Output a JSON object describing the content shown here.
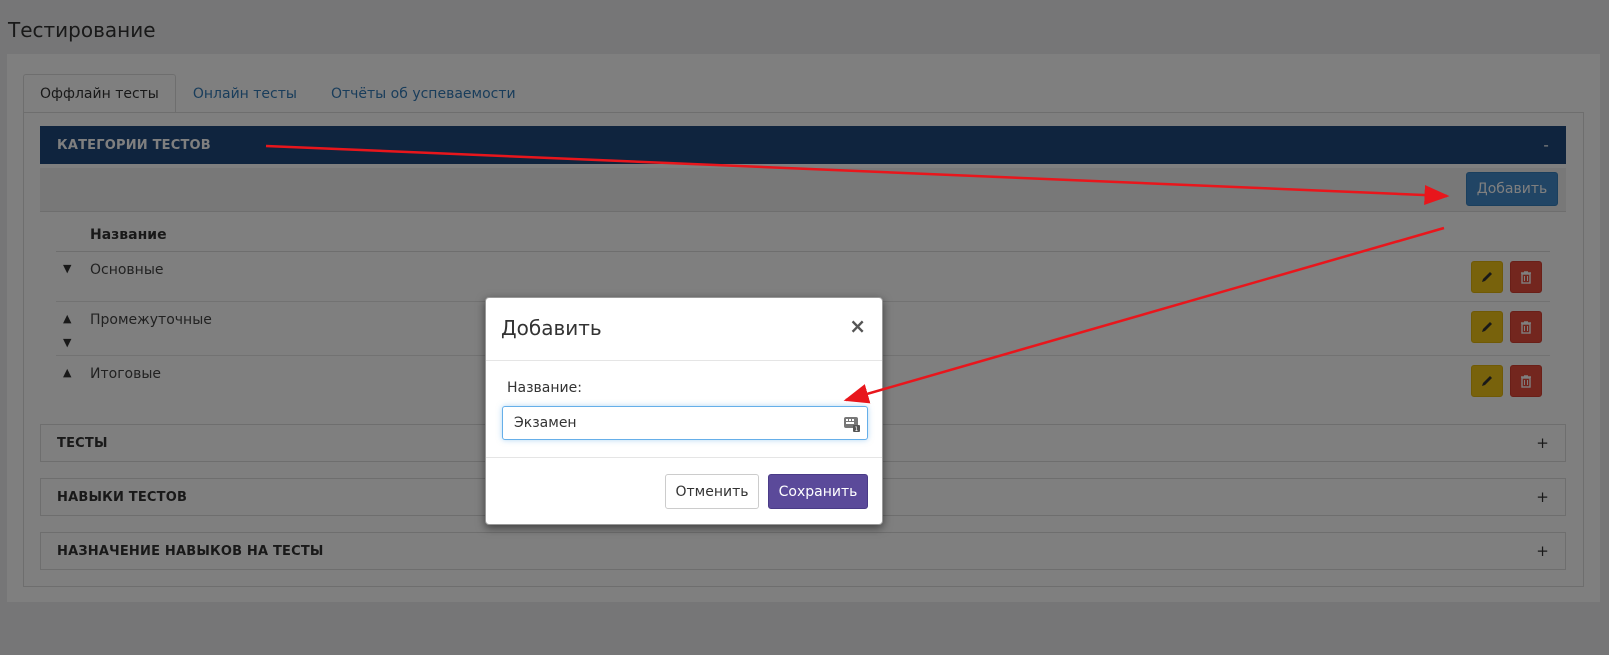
{
  "page": {
    "title": "Тестирование"
  },
  "tabs": [
    {
      "label": "Оффлайн тесты",
      "active": true
    },
    {
      "label": "Онлайн тесты",
      "active": false
    },
    {
      "label": "Отчёты об успеваемости",
      "active": false
    }
  ],
  "sections": [
    {
      "title": "КАТЕГОРИИ ТЕСТОВ",
      "toggle": "-",
      "expanded": true
    },
    {
      "title": "ТЕСТЫ",
      "toggle": "+",
      "expanded": false
    },
    {
      "title": "НАВЫКИ ТЕСТОВ",
      "toggle": "+",
      "expanded": false
    },
    {
      "title": "НАЗНАЧЕНИЕ НАВЫКОВ НА ТЕСТЫ",
      "toggle": "+",
      "expanded": false
    }
  ],
  "toolbar": {
    "add_label": "Добавить"
  },
  "table": {
    "header": "Название",
    "rows": [
      {
        "name": "Основные"
      },
      {
        "name": "Промежуточные"
      },
      {
        "name": "Итоговые"
      }
    ]
  },
  "icons": {
    "edit": "pencil-icon",
    "delete": "trash-icon",
    "move_up": "arrow-up-icon",
    "move_down": "arrow-down-icon",
    "input_helper": "keyboard-icon"
  },
  "modal": {
    "title": "Добавить",
    "close": "×",
    "field_label": "Название:",
    "field_value": "Экзамен",
    "cancel_label": "Отменить",
    "save_label": "Сохранить"
  },
  "colors": {
    "section_active": "#1f497d",
    "add_button": "#428bca",
    "edit_button": "#f0c419",
    "delete_button": "#e74c3c",
    "save_button": "#5b4a9a",
    "annotation_arrow": "#e8161c"
  }
}
